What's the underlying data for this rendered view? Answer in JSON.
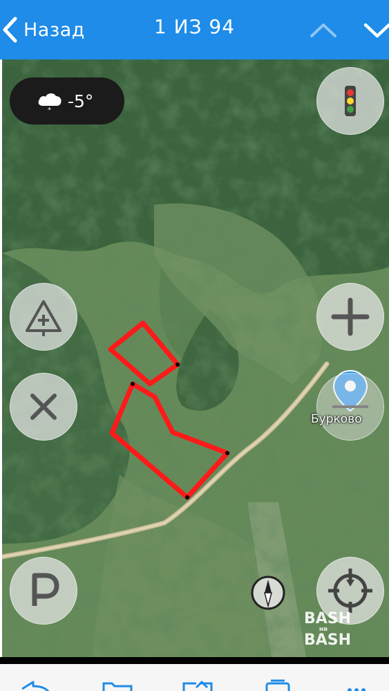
{
  "header": {
    "back_label": "Назад",
    "counter": "1 ИЗ 94"
  },
  "weather": {
    "temperature": "-5°",
    "icon": "cloud-snow-icon"
  },
  "map": {
    "type": "satellite",
    "place_label": "Бурково",
    "controls": {
      "traffic": "traffic-light-icon",
      "road_event": "road-event-add-icon",
      "close": "close-icon",
      "zoom_in": "plus-icon",
      "parking": "parking-icon",
      "location": "my-location-icon",
      "compass": "compass-icon"
    },
    "highlight_color": "#ff1a1a",
    "pin_color": "#1e8ce8"
  },
  "watermark": {
    "line1": "BASH",
    "middle": "на",
    "line2": "BASH"
  },
  "toolbar": {
    "icons": [
      "reply-icon",
      "folder-icon",
      "share-icon",
      "print-icon",
      "more-icon"
    ]
  },
  "colors": {
    "header_bg": "#1e8ce8",
    "header_text": "#ffffff"
  }
}
